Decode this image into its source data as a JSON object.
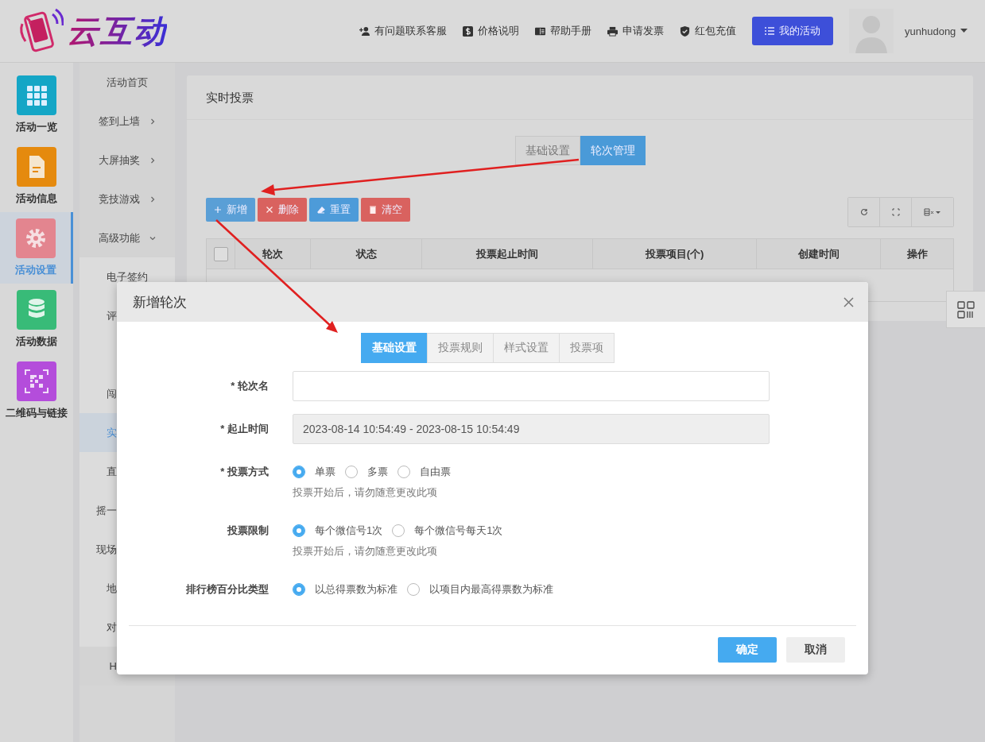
{
  "header": {
    "logo_text": "云互动",
    "links": [
      {
        "label": "有问题联系客服"
      },
      {
        "label": "价格说明"
      },
      {
        "label": "帮助手册"
      },
      {
        "label": "申请发票"
      },
      {
        "label": "红包充值"
      }
    ],
    "primary_button": "我的活动",
    "username": "yunhudong"
  },
  "rail": [
    {
      "label": "活动一览",
      "color": "#14a6c6",
      "selected": false
    },
    {
      "label": "活动信息",
      "color": "#e58a0e",
      "selected": false
    },
    {
      "label": "活动设置",
      "color": "#e3858f",
      "selected": true
    },
    {
      "label": "活动数据",
      "color": "#38bb78",
      "selected": false
    },
    {
      "label": "二维码与链接",
      "color": "#b44ddb",
      "selected": false
    }
  ],
  "menu": [
    {
      "label": "活动首页",
      "kind": "full",
      "selected": false
    },
    {
      "label": "签到上墙",
      "kind": "full",
      "expanded": false,
      "selected": false
    },
    {
      "label": "大屏抽奖",
      "kind": "full",
      "expanded": false,
      "selected": false
    },
    {
      "label": "竞技游戏",
      "kind": "full",
      "expanded": false,
      "selected": false
    },
    {
      "label": "高级功能",
      "kind": "full",
      "expanded": true,
      "selected": false,
      "children": [
        {
          "label": "电子签约",
          "kind": "full",
          "selected": false
        },
        {
          "label": "评",
          "kind": "cut",
          "selected": false
        },
        {
          "kind": "hidden"
        },
        {
          "label": "闯",
          "kind": "cut",
          "selected": false
        },
        {
          "label": "实",
          "kind": "cut",
          "selected": true
        },
        {
          "label": "直",
          "kind": "cut",
          "selected": false
        },
        {
          "label": "摇一",
          "kind": "cut",
          "selected": false
        },
        {
          "label": "现场",
          "kind": "cut",
          "selected": false
        },
        {
          "label": "地",
          "kind": "cut",
          "selected": false
        },
        {
          "label": "对",
          "kind": "cut",
          "selected": false
        }
      ]
    },
    {
      "label": "H",
      "kind": "cut",
      "selected": false
    }
  ],
  "page": {
    "title": "实时投票",
    "tabs": [
      {
        "label": "基础设置",
        "selected": false
      },
      {
        "label": "轮次管理",
        "selected": true
      }
    ],
    "actions": [
      {
        "label": "新增",
        "color": "#5a9fd6"
      },
      {
        "label": "删除",
        "color": "#d9625f"
      },
      {
        "label": "重置",
        "color": "#4d9bd9"
      },
      {
        "label": "清空",
        "color": "#d9625f"
      }
    ],
    "table": {
      "checked": false,
      "columns": [
        "轮次",
        "状态",
        "投票起止时间",
        "投票项目(个)",
        "创建时间",
        "操作"
      ]
    }
  },
  "dialog": {
    "title": "新增轮次",
    "tabs": [
      {
        "label": "基础设置",
        "selected": true
      },
      {
        "label": "投票规则",
        "selected": false
      },
      {
        "label": "样式设置",
        "selected": false
      },
      {
        "label": "投票项",
        "selected": false
      }
    ],
    "fields": [
      {
        "kind": "text",
        "label": "* 轮次名"
      },
      {
        "kind": "range",
        "label": "* 起止时间",
        "value": "2023-08-14 10:54:49 - 2023-08-15 10:54:49"
      },
      {
        "kind": "radio",
        "label": "* 投票方式",
        "options": [
          {
            "label": "单票",
            "selected": true
          },
          {
            "label": "多票",
            "selected": false
          },
          {
            "label": "自由票",
            "selected": false
          }
        ],
        "hint": "投票开始后，请勿随意更改此项"
      },
      {
        "kind": "radio",
        "label": "投票限制",
        "options": [
          {
            "label": "每个微信号1次",
            "selected": true
          },
          {
            "label": "每个微信号每天1次",
            "selected": false
          }
        ],
        "hint": "投票开始后，请勿随意更改此项"
      },
      {
        "kind": "radio",
        "label": "排行榜百分比类型",
        "options": [
          {
            "label": "以总得票数为标准",
            "selected": true
          },
          {
            "label": "以项目内最高得票数为标准",
            "selected": false
          }
        ]
      }
    ],
    "buttons": [
      {
        "label": "确定",
        "kind": "primary"
      },
      {
        "label": "取消",
        "kind": "secondary"
      }
    ]
  }
}
